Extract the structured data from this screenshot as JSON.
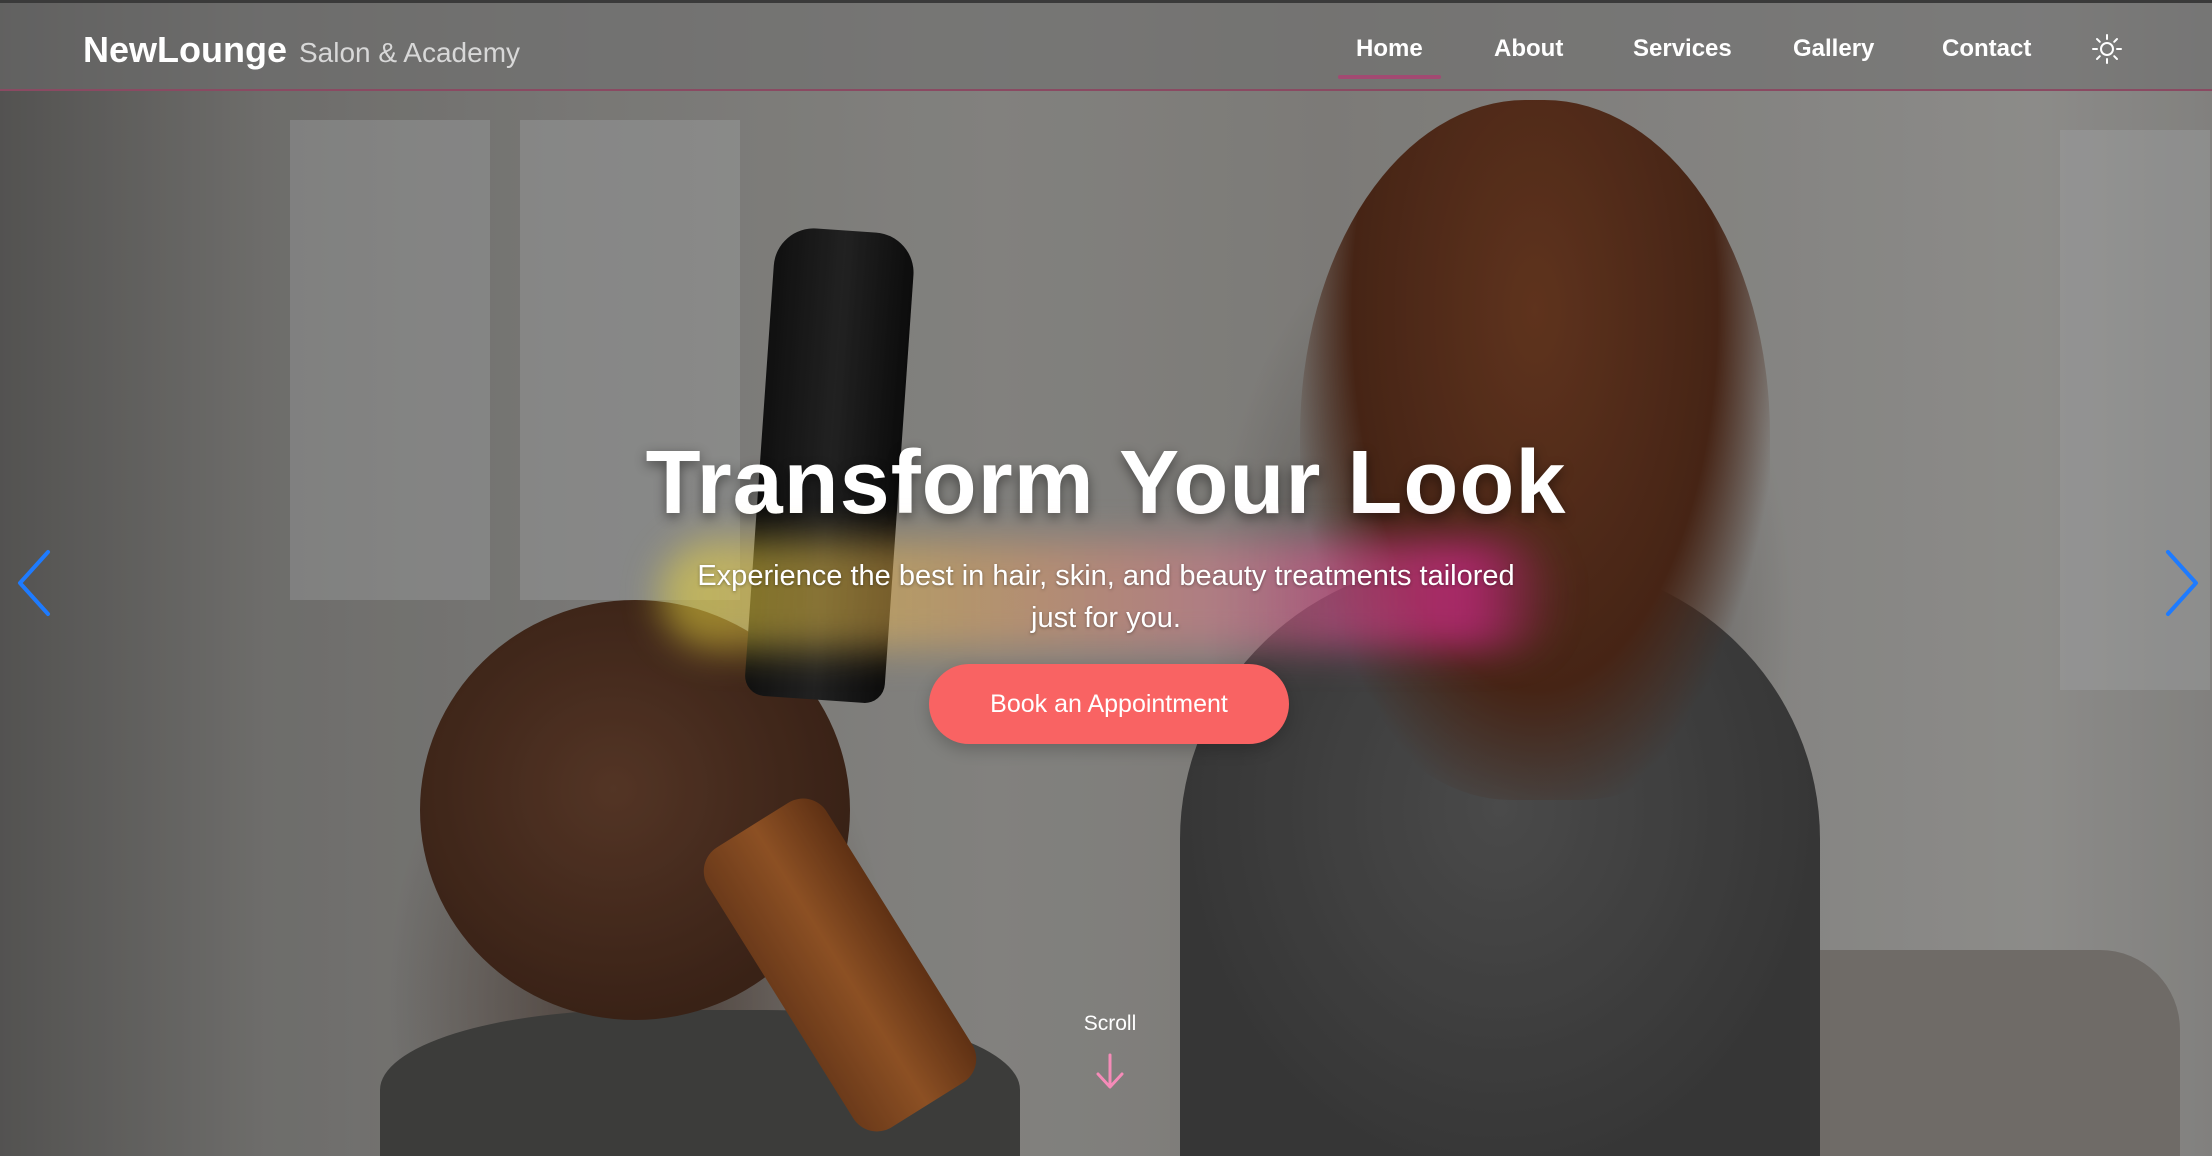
{
  "brand": {
    "name": "NewLounge",
    "tagline": "Salon & Academy"
  },
  "nav": {
    "items": [
      {
        "label": "Home",
        "active": true
      },
      {
        "label": "About",
        "active": false
      },
      {
        "label": "Services",
        "active": false
      },
      {
        "label": "Gallery",
        "active": false
      },
      {
        "label": "Contact",
        "active": false
      }
    ],
    "theme_toggle_icon": "sun-icon"
  },
  "hero": {
    "title": "Transform Your Look",
    "subtitle": "Experience the best in hair, skin, and beauty treatments tailored just for you.",
    "cta_label": "Book an Appointment",
    "scroll_label": "Scroll"
  },
  "carousel": {
    "prev_icon": "chevron-left-icon",
    "next_icon": "chevron-right-icon"
  },
  "colors": {
    "accent": "#f96363",
    "active_underline": "#a24a72",
    "arrow": "#1e7bff",
    "scroll_arrow": "#f58bb8"
  }
}
